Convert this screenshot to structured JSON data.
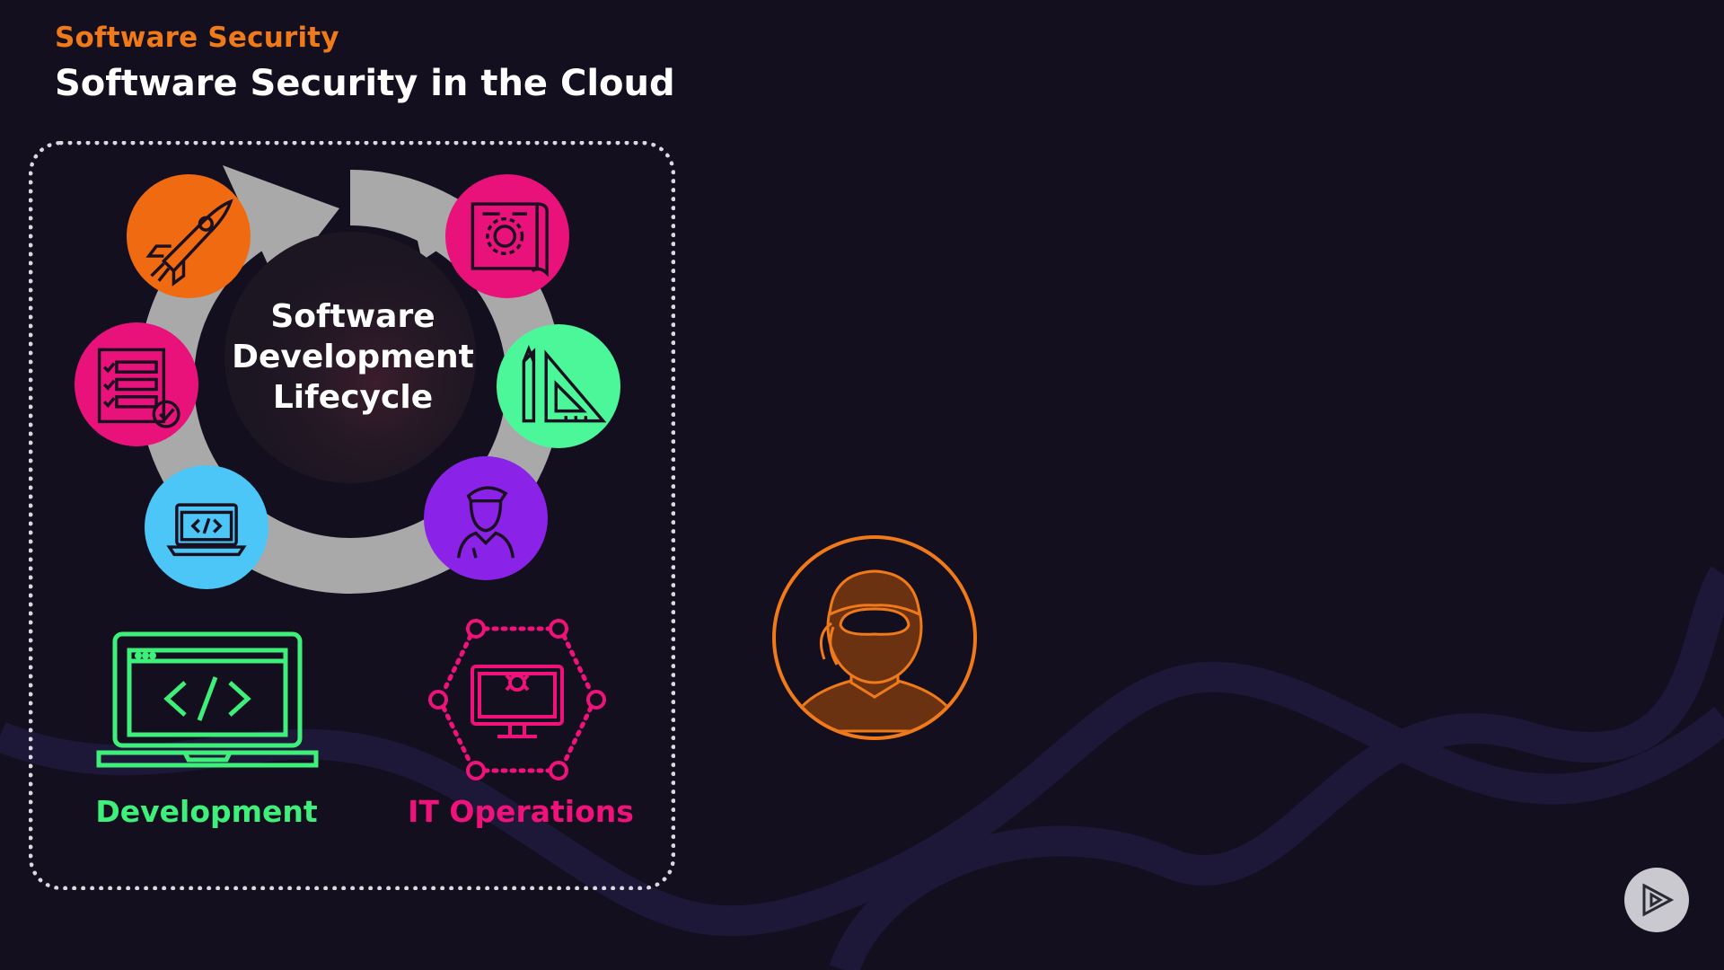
{
  "header": {
    "kicker": "Software Security",
    "title": "Software Security in the Cloud"
  },
  "cycle": {
    "center_lines": [
      "Software",
      "Development",
      "Lifecycle"
    ],
    "stages": [
      {
        "icon": "rocket-icon",
        "color": "#f06a12"
      },
      {
        "icon": "blueprint-gear-icon",
        "color": "#e8127a"
      },
      {
        "icon": "pencil-ruler-icon",
        "color": "#4cf79a"
      },
      {
        "icon": "designer-person-icon",
        "color": "#8a22e8"
      },
      {
        "icon": "laptop-code-icon",
        "color": "#4cc6f7"
      },
      {
        "icon": "checklist-icon",
        "color": "#e8127a"
      }
    ]
  },
  "teams": {
    "development": {
      "label": "Development",
      "icon": "laptop-code-icon",
      "color": "#3ef07a"
    },
    "operations": {
      "label": "IT Operations",
      "icon": "monitor-gear-network-icon",
      "color": "#f0127a"
    }
  },
  "threat": {
    "icon": "hacker-icon",
    "color": "#f07a1a"
  },
  "colors": {
    "background": "#130f1f",
    "accent": "#f07a1a"
  },
  "controls": {
    "play_icon": "play-icon"
  }
}
